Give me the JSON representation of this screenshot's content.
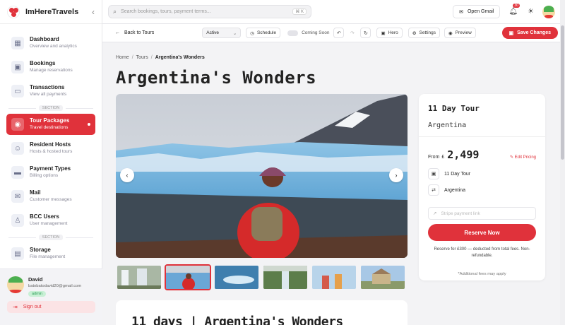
{
  "app": {
    "name": "ImHereTravels"
  },
  "sidebar": {
    "items": [
      {
        "label": "Dashboard",
        "sub": "Overview and analytics",
        "icon": "grid-icon"
      },
      {
        "label": "Bookings",
        "sub": "Manage reservations",
        "icon": "calendar-icon"
      },
      {
        "label": "Transactions",
        "sub": "View all payments",
        "icon": "cash-icon"
      },
      {
        "label": "Tour Packages",
        "sub": "Travel destinations",
        "icon": "location-pin-icon",
        "active": true
      },
      {
        "label": "Resident Hosts",
        "sub": "Hosts & hosted tours",
        "icon": "users-icon"
      },
      {
        "label": "Payment Types",
        "sub": "Billing options",
        "icon": "card-icon"
      },
      {
        "label": "Mail",
        "sub": "Customer messages",
        "icon": "chat-icon"
      },
      {
        "label": "BCC Users",
        "sub": "User management",
        "icon": "user-icon"
      },
      {
        "label": "Storage",
        "sub": "File management",
        "icon": "folder-icon"
      }
    ],
    "section_label": "SECTION"
  },
  "profile": {
    "name": "David",
    "email": "batobatodavid20@gmail.com",
    "role": "admin",
    "signout": "Sign out"
  },
  "topbar": {
    "search_placeholder": "Search bookings, tours, payment terms...",
    "shortcut": "⌘ K",
    "gmail_label": "Open Gmail",
    "notification_count": "30"
  },
  "toolbar": {
    "back_label": "Back to Tours",
    "status": "Active",
    "schedule_label": "Schedule",
    "coming_soon_label": "Coming Soon",
    "hero_label": "Hero",
    "settings_label": "Settings",
    "preview_label": "Preview",
    "save_label": "Save Changes"
  },
  "breadcrumb": {
    "home": "Home",
    "tours": "Tours",
    "current": "Argentina's Wonders"
  },
  "page": {
    "title": "Argentina's Wonders",
    "section_title": "11 days | Argentina's Wonders"
  },
  "tour_card": {
    "title": "11 Day Tour",
    "country": "Argentina",
    "price_prefix": "From",
    "currency": "£",
    "price": "2,499",
    "edit_label": "Edit Pricing",
    "duration": "11 Day Tour",
    "destination": "Argentina",
    "stripe_placeholder": "Stripe payment link",
    "reserve_label": "Reserve Now",
    "reserve_note": "Reserve for £300 — deducted from total fees. Non-refundable.",
    "fees_note": "*Additional fees may apply"
  },
  "colors": {
    "accent": "#e0323b",
    "active_badge": "#c8f0d5"
  }
}
